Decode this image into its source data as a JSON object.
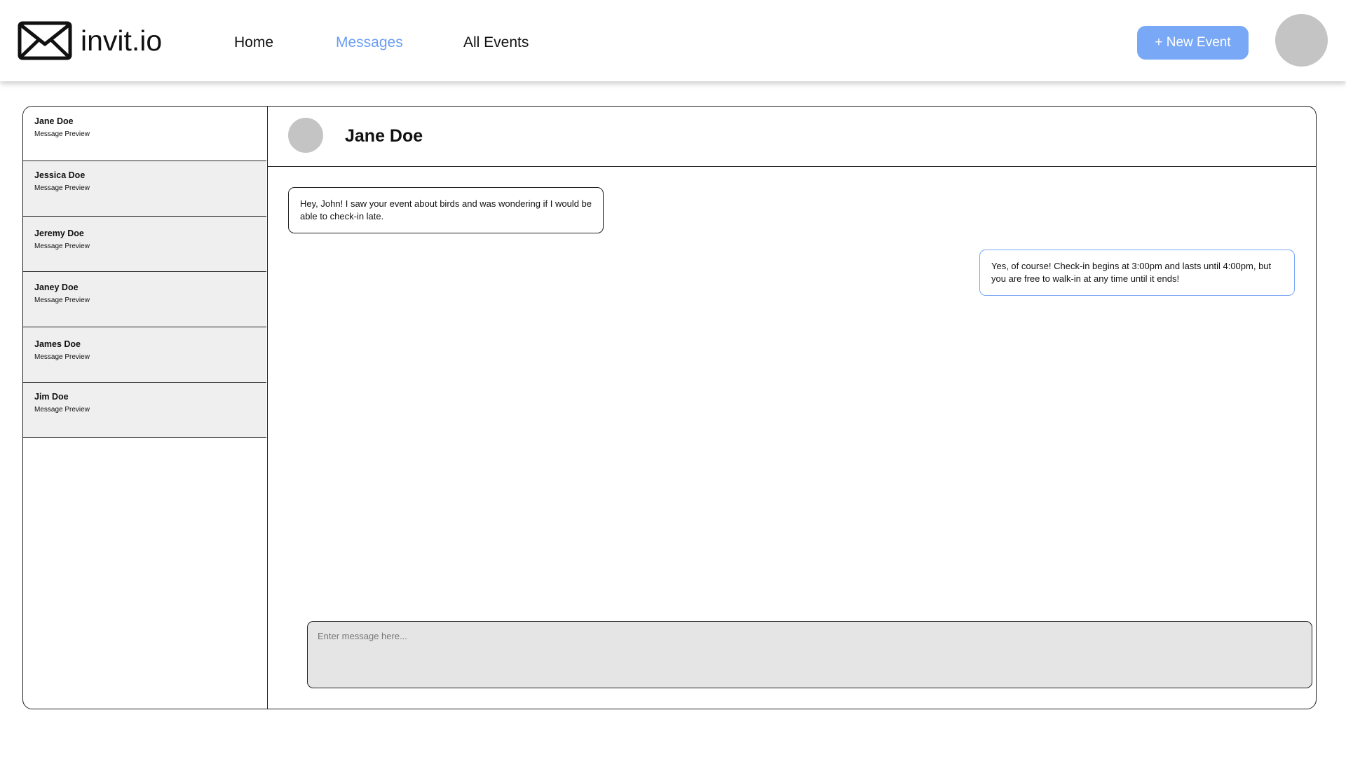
{
  "app": {
    "brand": "invit.io"
  },
  "nav": {
    "home": "Home",
    "messages": "Messages",
    "all_events": "All Events",
    "active": "messages"
  },
  "actions": {
    "new_event": "+ New Event"
  },
  "colors": {
    "accent": "#79a8f7",
    "nav_active": "#6a9df5",
    "avatar": "#c4c4c4",
    "list_item_bg": "#efefef",
    "input_bg": "#e5e5e5"
  },
  "conversations": [
    {
      "name": "Jane Doe",
      "preview": "Message Preview",
      "selected": true
    },
    {
      "name": "Jessica Doe",
      "preview": "Message Preview",
      "selected": false
    },
    {
      "name": "Jeremy Doe",
      "preview": "Message Preview",
      "selected": false
    },
    {
      "name": "Janey Doe",
      "preview": "Message Preview",
      "selected": false
    },
    {
      "name": "James Doe",
      "preview": "Message Preview",
      "selected": false
    },
    {
      "name": "Jim Doe",
      "preview": "Message Preview",
      "selected": false
    }
  ],
  "chat": {
    "contact_name": "Jane Doe",
    "messages": [
      {
        "direction": "incoming",
        "text": "Hey, John! I saw your event about birds and was wondering if I would be able to check-in late."
      },
      {
        "direction": "outgoing",
        "text": "Yes, of course! Check-in begins at 3:00pm and lasts until 4:00pm, but you are free to walk-in at any time until it ends!"
      }
    ],
    "input_placeholder": "Enter message here..."
  }
}
